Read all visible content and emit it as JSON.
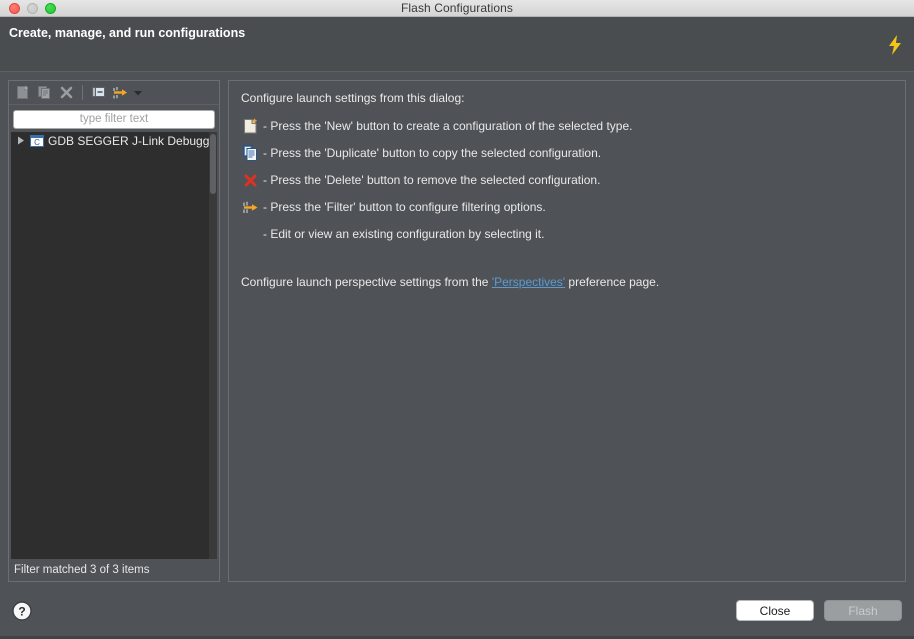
{
  "window": {
    "title": "Flash Configurations",
    "traffic_lights": [
      "close-red",
      "minimize-gray",
      "maximize-green"
    ]
  },
  "header": {
    "title": "Create, manage, and run configurations",
    "icon": "lightning-bolt-icon",
    "icon_color": "#f5c518"
  },
  "left_panel": {
    "toolbar": [
      {
        "name": "new-configuration-button",
        "icon": "new-document-icon",
        "enabled": false
      },
      {
        "name": "duplicate-configuration-button",
        "icon": "duplicate-document-icon",
        "enabled": false
      },
      {
        "name": "delete-configuration-button",
        "icon": "delete-x-icon",
        "enabled": false
      },
      {
        "name": "collapse-all-button",
        "icon": "collapse-all-icon",
        "enabled": true
      },
      {
        "name": "filter-button",
        "icon": "filter-arrow-icon",
        "enabled": true
      }
    ],
    "filter": {
      "placeholder": "type filter text",
      "value": ""
    },
    "tree": {
      "items": [
        {
          "label": "GDB SEGGER J-Link Debugging",
          "icon": "c-file-icon",
          "expanded": false,
          "expander": "triangle-right-icon"
        }
      ]
    },
    "status": "Filter matched 3 of 3 items"
  },
  "right_panel": {
    "intro": "Configure launch settings from this dialog:",
    "rows": [
      {
        "icon": "new-document-icon",
        "text": "- Press the 'New' button to create a configuration of the selected type."
      },
      {
        "icon": "duplicate-document-icon",
        "text": "- Press the 'Duplicate' button to copy the selected configuration."
      },
      {
        "icon": "delete-x-icon",
        "text": "- Press the 'Delete' button to remove the selected configuration."
      },
      {
        "icon": "filter-arrow-icon",
        "text": "- Press the 'Filter' button to configure filtering options."
      },
      {
        "icon": "none",
        "text": "- Edit or view an existing configuration by selecting it."
      }
    ],
    "footer_prefix": "Configure launch perspective settings from the ",
    "footer_link": "'Perspectives'",
    "footer_suffix": " preference page.",
    "link_color": "#5a9bd4"
  },
  "footer": {
    "help_icon": "help-question-icon",
    "close_label": "Close",
    "flash_label": "Flash",
    "flash_enabled": false
  },
  "colors": {
    "dialog_background": "#4f5357",
    "header_background": "#4a4d50",
    "tree_background": "#2e2e2e",
    "text": "#e9e9e9",
    "accent": "#f5a623"
  }
}
